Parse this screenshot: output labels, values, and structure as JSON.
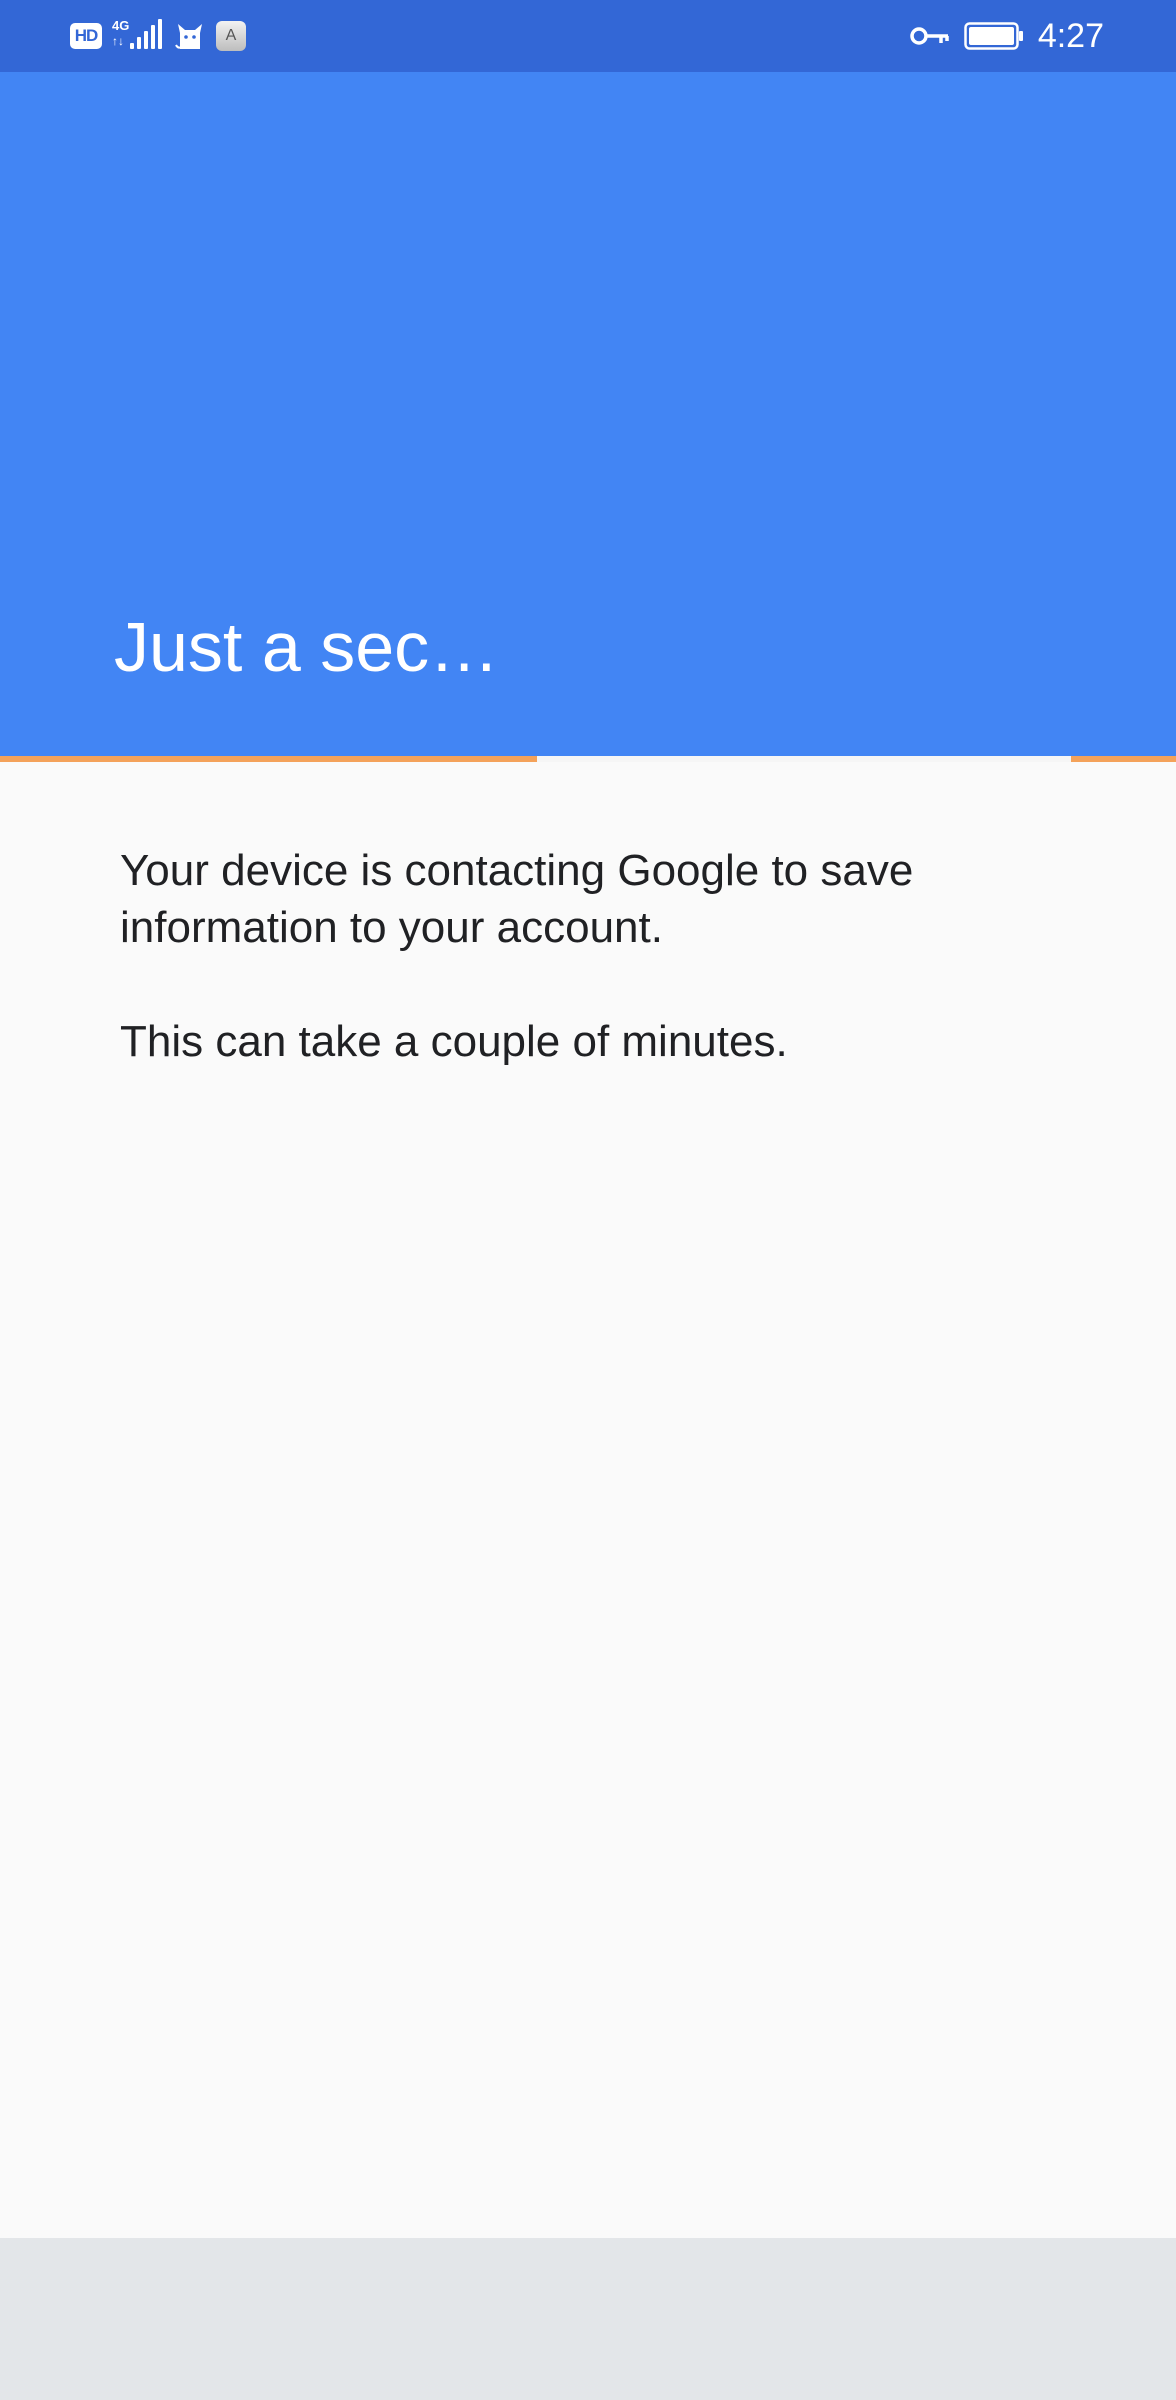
{
  "status_bar": {
    "hd_label": "HD",
    "network_label": "4G",
    "a_label": "A",
    "time": "4:27",
    "battery_percent": 100,
    "icons": [
      "hd-icon",
      "signal-4g-icon",
      "cat-app-icon",
      "a-app-icon",
      "vpn-key-icon",
      "battery-icon"
    ]
  },
  "header": {
    "title": "Just a sec…"
  },
  "progress": {
    "type": "indeterminate",
    "accent_color": "#f4a25a"
  },
  "content": {
    "paragraph_1": "Your device is contacting Google to save information to your account.",
    "paragraph_2": "This can take a couple of minutes."
  },
  "colors": {
    "status_bar": "#3367d6",
    "header": "#4285f4",
    "background": "#fafafa",
    "text": "#202124",
    "bottom_bar": "#e3e6e9"
  }
}
